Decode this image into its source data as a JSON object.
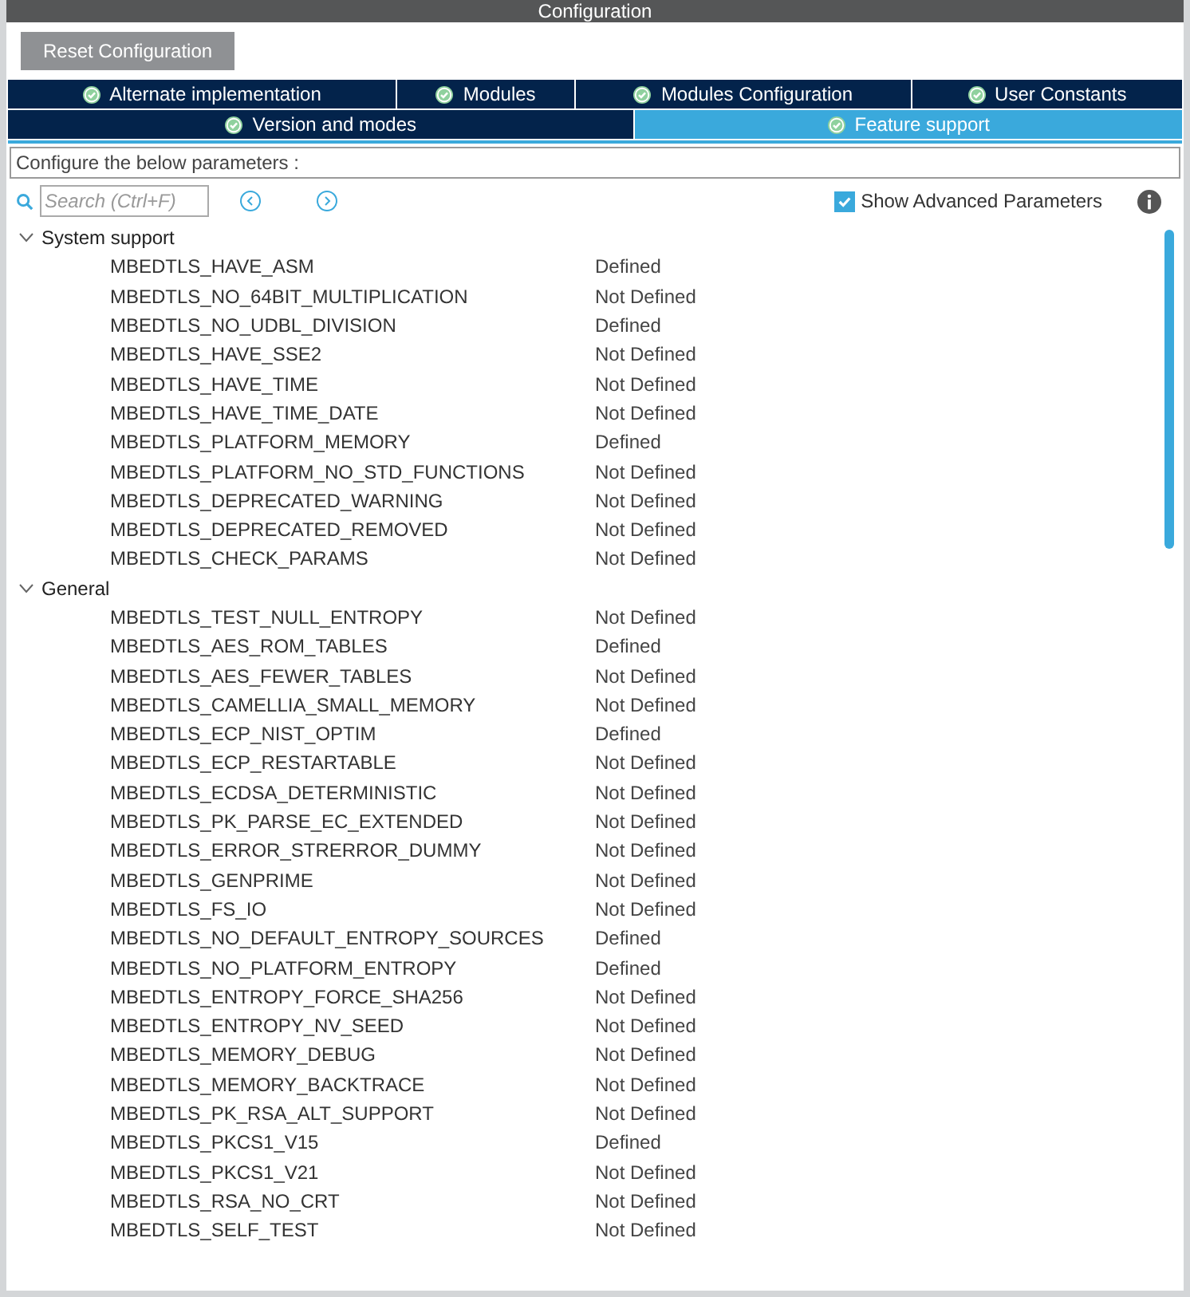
{
  "header": {
    "title": "Configuration"
  },
  "reset_button": "Reset Configuration",
  "tab_rows": [
    [
      {
        "label": "Alternate implementation",
        "selected": false
      },
      {
        "label": "Modules",
        "selected": false
      },
      {
        "label": "Modules Configuration",
        "selected": false
      },
      {
        "label": "User Constants",
        "selected": false
      }
    ],
    [
      {
        "label": "Version and modes",
        "selected": false
      },
      {
        "label": "Feature support",
        "selected": true
      }
    ]
  ],
  "description": "Configure the below parameters :",
  "search": {
    "placeholder": "Search (Ctrl+F)"
  },
  "show_advanced": {
    "label": "Show Advanced Parameters",
    "checked": true
  },
  "groups": [
    {
      "name": "System support",
      "expanded": true,
      "children": [
        {
          "name": "MBEDTLS_HAVE_ASM",
          "value": "Defined"
        },
        {
          "name": "MBEDTLS_NO_64BIT_MULTIPLICATION",
          "value": "Not Defined"
        },
        {
          "name": "MBEDTLS_NO_UDBL_DIVISION",
          "value": "Defined"
        },
        {
          "name": "MBEDTLS_HAVE_SSE2",
          "value": "Not Defined"
        },
        {
          "name": "MBEDTLS_HAVE_TIME",
          "value": "Not Defined"
        },
        {
          "name": "MBEDTLS_HAVE_TIME_DATE",
          "value": "Not Defined"
        },
        {
          "name": "MBEDTLS_PLATFORM_MEMORY",
          "value": "Defined"
        },
        {
          "name": "MBEDTLS_PLATFORM_NO_STD_FUNCTIONS",
          "value": "Not Defined"
        },
        {
          "name": "MBEDTLS_DEPRECATED_WARNING",
          "value": "Not Defined"
        },
        {
          "name": "MBEDTLS_DEPRECATED_REMOVED",
          "value": "Not Defined"
        },
        {
          "name": "MBEDTLS_CHECK_PARAMS",
          "value": "Not Defined"
        }
      ]
    },
    {
      "name": "General",
      "expanded": true,
      "children": [
        {
          "name": "MBEDTLS_TEST_NULL_ENTROPY",
          "value": "Not Defined"
        },
        {
          "name": "MBEDTLS_AES_ROM_TABLES",
          "value": "Defined"
        },
        {
          "name": "MBEDTLS_AES_FEWER_TABLES",
          "value": "Not Defined"
        },
        {
          "name": "MBEDTLS_CAMELLIA_SMALL_MEMORY",
          "value": "Not Defined"
        },
        {
          "name": "MBEDTLS_ECP_NIST_OPTIM",
          "value": "Defined"
        },
        {
          "name": "MBEDTLS_ECP_RESTARTABLE",
          "value": "Not Defined"
        },
        {
          "name": "MBEDTLS_ECDSA_DETERMINISTIC",
          "value": "Not Defined"
        },
        {
          "name": "MBEDTLS_PK_PARSE_EC_EXTENDED",
          "value": "Not Defined"
        },
        {
          "name": "MBEDTLS_ERROR_STRERROR_DUMMY",
          "value": "Not Defined"
        },
        {
          "name": "MBEDTLS_GENPRIME",
          "value": "Not Defined"
        },
        {
          "name": "MBEDTLS_FS_IO",
          "value": "Not Defined"
        },
        {
          "name": "MBEDTLS_NO_DEFAULT_ENTROPY_SOURCES",
          "value": "Defined"
        },
        {
          "name": "MBEDTLS_NO_PLATFORM_ENTROPY",
          "value": "Defined"
        },
        {
          "name": "MBEDTLS_ENTROPY_FORCE_SHA256",
          "value": "Not Defined"
        },
        {
          "name": "MBEDTLS_ENTROPY_NV_SEED",
          "value": "Not Defined"
        },
        {
          "name": "MBEDTLS_MEMORY_DEBUG",
          "value": "Not Defined"
        },
        {
          "name": "MBEDTLS_MEMORY_BACKTRACE",
          "value": "Not Defined"
        },
        {
          "name": "MBEDTLS_PK_RSA_ALT_SUPPORT",
          "value": "Not Defined"
        },
        {
          "name": "MBEDTLS_PKCS1_V15",
          "value": "Defined"
        },
        {
          "name": "MBEDTLS_PKCS1_V21",
          "value": "Not Defined"
        },
        {
          "name": "MBEDTLS_RSA_NO_CRT",
          "value": "Not Defined"
        },
        {
          "name": "MBEDTLS_SELF_TEST",
          "value": "Not Defined"
        }
      ]
    }
  ]
}
